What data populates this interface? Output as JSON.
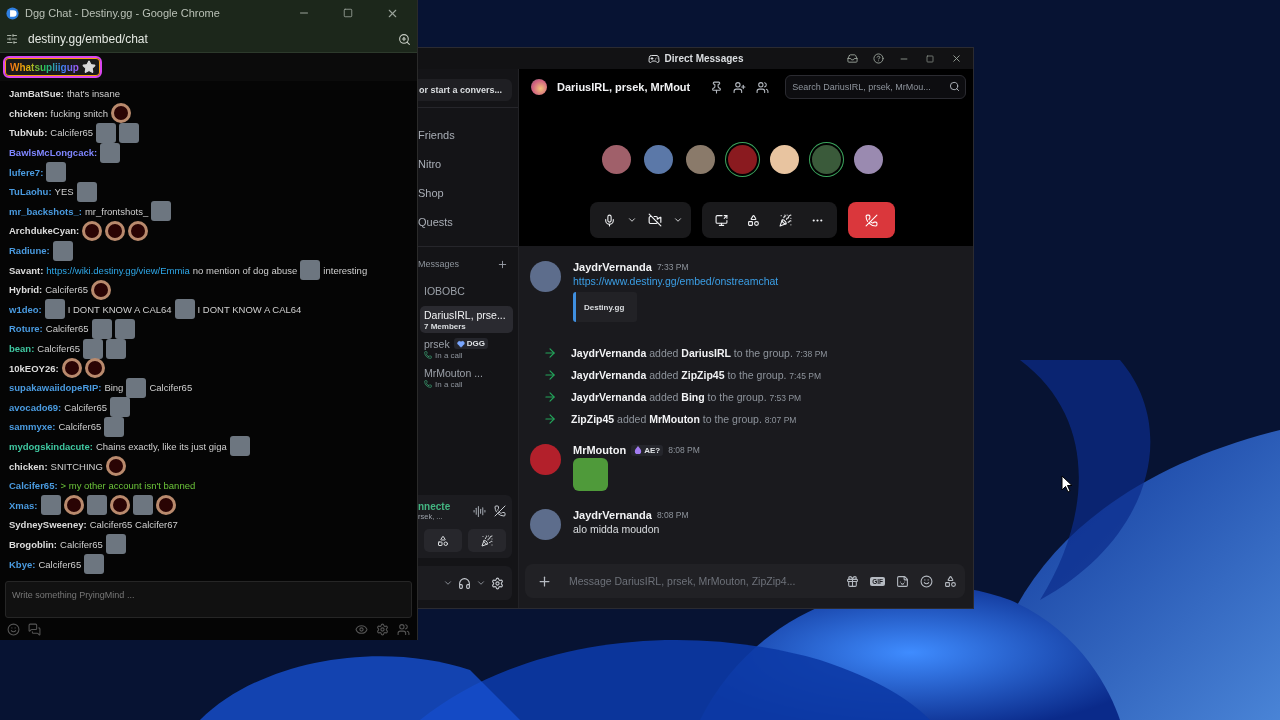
{
  "chat_window": {
    "title": "Dgg Chat - Destiny.gg - Google Chrome",
    "url": "destiny.gg/embed/chat",
    "highlight_user": "Whatsupliigup",
    "messages": [
      {
        "user": "JamBatSue:",
        "color": "#dcdcdc",
        "parts": [
          {
            "kind": "text",
            "text": "that's insane"
          }
        ]
      },
      {
        "user": "chicken:",
        "color": "#dcdcdc",
        "parts": [
          {
            "kind": "text",
            "text": "fucking snitch"
          },
          {
            "kind": "ring_emote"
          }
        ]
      },
      {
        "user": "TubNub:",
        "color": "#dcdcdc",
        "parts": [
          {
            "kind": "text",
            "text": "Calcifer65"
          },
          {
            "kind": "image_emote"
          },
          {
            "kind": "image_emote"
          }
        ]
      },
      {
        "user": "BawlsMcLongcack:",
        "color": "#7f86ff",
        "parts": [
          {
            "kind": "image_emote"
          }
        ]
      },
      {
        "user": "lufere7:",
        "color": "#4a9be0",
        "parts": [
          {
            "kind": "image_emote"
          }
        ]
      },
      {
        "user": "TuLaohu:",
        "color": "#4a9be0",
        "parts": [
          {
            "kind": "text",
            "text": "YES"
          },
          {
            "kind": "image_emote"
          }
        ]
      },
      {
        "user": "mr_backshots_:",
        "color": "#4a9be0",
        "parts": [
          {
            "kind": "text",
            "text": "mr_frontshots_"
          },
          {
            "kind": "image_emote"
          }
        ]
      },
      {
        "user": "ArchdukeCyan:",
        "color": "#dcdcdc",
        "parts": [
          {
            "kind": "ring_emote"
          },
          {
            "kind": "ring_emote"
          },
          {
            "kind": "ring_emote"
          }
        ]
      },
      {
        "user": "Radiune:",
        "color": "#4a9be0",
        "parts": [
          {
            "kind": "image_emote"
          }
        ]
      },
      {
        "user": "Savant:",
        "color": "#dcdcdc",
        "parts": [
          {
            "kind": "link",
            "text": "https://wiki.destiny.gg/view/Emmia"
          },
          {
            "kind": "text",
            "text": "no mention of dog abuse"
          },
          {
            "kind": "image_emote"
          },
          {
            "kind": "text",
            "text": "interesting"
          }
        ]
      },
      {
        "user": "Hybrid:",
        "color": "#dcdcdc",
        "parts": [
          {
            "kind": "text",
            "text": "Calcifer65"
          },
          {
            "kind": "ring_emote"
          }
        ]
      },
      {
        "user": "w1deo:",
        "color": "#4a9be0",
        "parts": [
          {
            "kind": "image_emote"
          },
          {
            "kind": "text",
            "text": "I DONT KNOW A CAL64"
          },
          {
            "kind": "image_emote"
          },
          {
            "kind": "text",
            "text": "I DONT KNOW A CAL64"
          }
        ]
      },
      {
        "user": "Roture:",
        "color": "#4a9be0",
        "parts": [
          {
            "kind": "text",
            "text": "Calcifer65"
          },
          {
            "kind": "image_emote"
          },
          {
            "kind": "image_emote"
          }
        ]
      },
      {
        "user": "bean:",
        "color": "#3fc7a0",
        "parts": [
          {
            "kind": "text",
            "text": "Calcifer65"
          },
          {
            "kind": "image_emote"
          },
          {
            "kind": "image_emote"
          }
        ]
      },
      {
        "user": "10kEOY26:",
        "color": "#dcdcdc",
        "parts": [
          {
            "kind": "ring_emote"
          },
          {
            "kind": "ring_emote"
          }
        ]
      },
      {
        "user": "supakawaiidopeRIP:",
        "color": "#4a9be0",
        "parts": [
          {
            "kind": "text",
            "text": "Bing"
          },
          {
            "kind": "image_emote"
          },
          {
            "kind": "text",
            "text": "Calcifer65"
          }
        ]
      },
      {
        "user": "avocado69:",
        "color": "#4a9be0",
        "parts": [
          {
            "kind": "text",
            "text": "Calcifer65"
          },
          {
            "kind": "image_emote"
          }
        ]
      },
      {
        "user": "sammyxe:",
        "color": "#4a9be0",
        "parts": [
          {
            "kind": "text",
            "text": "Calcifer65"
          },
          {
            "kind": "image_emote"
          }
        ]
      },
      {
        "user": "mydogskindacute:",
        "color": "#3fc7a0",
        "parts": [
          {
            "kind": "text",
            "text": "Chains exactly, like its just giga"
          },
          {
            "kind": "image_emote"
          }
        ]
      },
      {
        "user": "chicken:",
        "color": "#dcdcdc",
        "parts": [
          {
            "kind": "text",
            "text": "SNITCHING"
          },
          {
            "kind": "ring_emote"
          }
        ]
      },
      {
        "user": "Calcifer65:",
        "color": "#4a9be0",
        "parts": [
          {
            "kind": "greentext",
            "text": "> my other account isn't banned"
          }
        ]
      },
      {
        "user": "Xmas:",
        "color": "#4a9be0",
        "parts": [
          {
            "kind": "image_emote"
          },
          {
            "kind": "ring_emote"
          },
          {
            "kind": "image_emote"
          },
          {
            "kind": "ring_emote"
          },
          {
            "kind": "image_emote"
          },
          {
            "kind": "ring_emote"
          }
        ]
      },
      {
        "user": "SydneySweeney:",
        "color": "#dcdcdc",
        "parts": [
          {
            "kind": "text",
            "text": "Calcifer65 Calcifer67"
          }
        ]
      },
      {
        "user": "Brogoblin:",
        "color": "#dcdcdc",
        "parts": [
          {
            "kind": "text",
            "text": "Calcifer65"
          },
          {
            "kind": "image_emote"
          }
        ]
      },
      {
        "user": "Kbye:",
        "color": "#4a9be0",
        "parts": [
          {
            "kind": "text",
            "text": "Calcifer65"
          },
          {
            "kind": "image_emote"
          }
        ]
      }
    ],
    "input": {
      "placeholder": "Write something PryingMind ..."
    }
  },
  "discord_window": {
    "title": "Direct Messages",
    "sidebar": {
      "search": "or start a convers...",
      "nav": [
        {
          "label": "Friends"
        },
        {
          "label": "Nitro"
        },
        {
          "label": "Shop"
        },
        {
          "label": "Quests"
        }
      ],
      "section": "Messages",
      "dms": [
        {
          "name": "IOBOBC",
          "selected": false
        },
        {
          "name": "DariusIRL, prse...",
          "subtitle": "7 Members",
          "selected": true
        },
        {
          "name": "prsek",
          "badge": "DGG",
          "status": "In a call",
          "selected": false
        },
        {
          "name": "MrMouton ...",
          "status": "In a call",
          "selected": false
        }
      ],
      "voice": {
        "status": "nnecte",
        "channel": "rsek, ..."
      }
    },
    "header": {
      "title": "DariusIRL, prsek, MrMout",
      "search_placeholder": "Search DariusIRL, prsek, MrMou..."
    },
    "call": {
      "participants": [
        {
          "speaking": false
        },
        {
          "speaking": false
        },
        {
          "speaking": false
        },
        {
          "speaking": true
        },
        {
          "speaking": false
        },
        {
          "speaking": true
        },
        {
          "speaking": false
        }
      ],
      "camera_on": false
    },
    "messages": [
      {
        "kind": "message",
        "author": "JaydrVernanda",
        "time": "7:33 PM",
        "link": "https://www.destiny.gg/embed/onstreamchat",
        "embed": "Destiny.gg"
      },
      {
        "kind": "system",
        "text": "**JaydrVernanda** added **DariusIRL** to the group.",
        "time": "7:38 PM"
      },
      {
        "kind": "system",
        "text": "**JaydrVernanda** added **ZipZip45** to the group.",
        "time": "7:45 PM"
      },
      {
        "kind": "system",
        "text": "**JaydrVernanda** added **Bing** to the group.",
        "time": "7:53 PM"
      },
      {
        "kind": "system",
        "text": "**ZipZip45** added **MrMouton** to the group.",
        "time": "8:07 PM"
      },
      {
        "kind": "message",
        "author": "MrMouton",
        "badge": "AE?",
        "time": "8:08 PM",
        "sticker": true
      },
      {
        "kind": "message",
        "author": "JaydrVernanda",
        "time": "8:08 PM",
        "text": "alo midda moudon"
      }
    ],
    "composer": {
      "placeholder": "Message DariusIRL, prsek, MrMouton, ZipZip4...",
      "gif_label": "GIF"
    }
  }
}
